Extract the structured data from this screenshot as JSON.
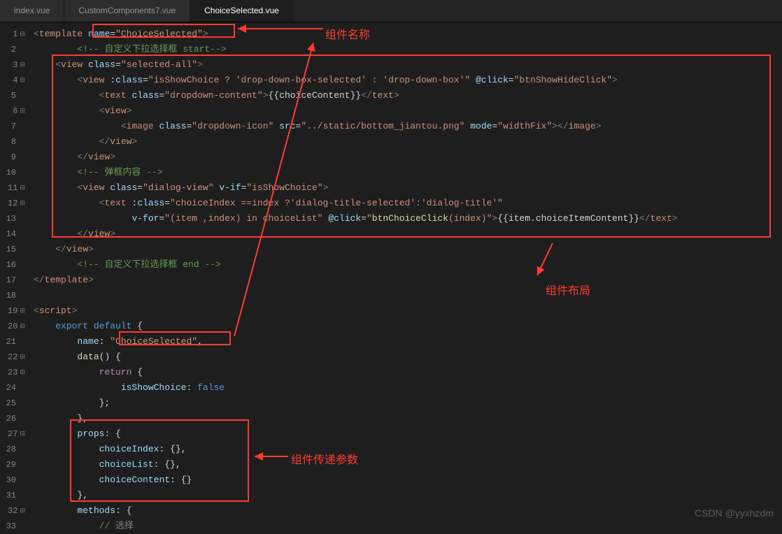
{
  "tabs": [
    "index.vue",
    "CustomComponents7.vue",
    "ChoiceSelected.vue"
  ],
  "active_tab": 2,
  "annotations": {
    "component_name": "组件名称",
    "component_layout": "组件布局",
    "component_props": "组件传递参数"
  },
  "watermark": "CSDN @yyxhzdm",
  "code_lines": [
    {
      "n": 1,
      "fold": true,
      "tokens": [
        [
          "br",
          "<"
        ],
        [
          "tag",
          "template"
        ],
        [
          "txt",
          " "
        ],
        [
          "attr",
          "name"
        ],
        [
          "op",
          "="
        ],
        [
          "str",
          "\"ChoiceSelected\""
        ],
        [
          "br",
          ">"
        ]
      ]
    },
    {
      "n": 2,
      "tokens": [
        [
          "sp",
          "        "
        ],
        [
          "cmt",
          "<!-- 自定义下拉选择框 start-->"
        ]
      ]
    },
    {
      "n": 3,
      "fold": true,
      "tokens": [
        [
          "sp",
          "    "
        ],
        [
          "br",
          "<"
        ],
        [
          "tag",
          "view"
        ],
        [
          "txt",
          " "
        ],
        [
          "attr",
          "class"
        ],
        [
          "op",
          "="
        ],
        [
          "str",
          "\"selected-all\""
        ],
        [
          "br",
          ">"
        ]
      ]
    },
    {
      "n": 4,
      "fold": true,
      "tokens": [
        [
          "sp",
          "        "
        ],
        [
          "br",
          "<"
        ],
        [
          "tag",
          "view"
        ],
        [
          "txt",
          " "
        ],
        [
          "attr",
          ":class"
        ],
        [
          "op",
          "="
        ],
        [
          "str",
          "\"isShowChoice ? 'drop-down-box-selected' : 'drop-down-box'\""
        ],
        [
          "txt",
          " "
        ],
        [
          "attr",
          "@click"
        ],
        [
          "op",
          "="
        ],
        [
          "str",
          "\"btnShowHideClick\""
        ],
        [
          "br",
          ">"
        ]
      ]
    },
    {
      "n": 5,
      "tokens": [
        [
          "sp",
          "            "
        ],
        [
          "br",
          "<"
        ],
        [
          "tag",
          "text"
        ],
        [
          "txt",
          " "
        ],
        [
          "attr",
          "class"
        ],
        [
          "op",
          "="
        ],
        [
          "str",
          "\"dropdown-content\""
        ],
        [
          "br",
          ">"
        ],
        [
          "txt",
          "{{choiceContent}}"
        ],
        [
          "br",
          "</"
        ],
        [
          "tag",
          "text"
        ],
        [
          "br",
          ">"
        ]
      ]
    },
    {
      "n": 6,
      "fold": true,
      "tokens": [
        [
          "sp",
          "            "
        ],
        [
          "br",
          "<"
        ],
        [
          "tag",
          "view"
        ],
        [
          "br",
          ">"
        ]
      ]
    },
    {
      "n": 7,
      "tokens": [
        [
          "sp",
          "                "
        ],
        [
          "br",
          "<"
        ],
        [
          "tag",
          "image"
        ],
        [
          "txt",
          " "
        ],
        [
          "attr",
          "class"
        ],
        [
          "op",
          "="
        ],
        [
          "str",
          "\"dropdown-icon\""
        ],
        [
          "txt",
          " "
        ],
        [
          "attr",
          "src"
        ],
        [
          "op",
          "="
        ],
        [
          "str",
          "\"../static/bottom_jiantou.png\""
        ],
        [
          "txt",
          " "
        ],
        [
          "attr",
          "mode"
        ],
        [
          "op",
          "="
        ],
        [
          "str",
          "\"widthFix\""
        ],
        [
          "br",
          "></"
        ],
        [
          "tag",
          "image"
        ],
        [
          "br",
          ">"
        ]
      ]
    },
    {
      "n": 8,
      "tokens": [
        [
          "sp",
          "            "
        ],
        [
          "br",
          "</"
        ],
        [
          "tag",
          "view"
        ],
        [
          "br",
          ">"
        ]
      ]
    },
    {
      "n": 9,
      "tokens": [
        [
          "sp",
          "        "
        ],
        [
          "br",
          "</"
        ],
        [
          "tag",
          "view"
        ],
        [
          "br",
          ">"
        ]
      ]
    },
    {
      "n": 10,
      "tokens": [
        [
          "sp",
          "        "
        ],
        [
          "cmt",
          "<!-- 弹框内容 -->"
        ]
      ]
    },
    {
      "n": 11,
      "fold": true,
      "tokens": [
        [
          "sp",
          "        "
        ],
        [
          "br",
          "<"
        ],
        [
          "tag",
          "view"
        ],
        [
          "txt",
          " "
        ],
        [
          "attr",
          "class"
        ],
        [
          "op",
          "="
        ],
        [
          "str",
          "\"dialog-view\""
        ],
        [
          "txt",
          " "
        ],
        [
          "attr",
          "v-if"
        ],
        [
          "op",
          "="
        ],
        [
          "str",
          "\"isShowChoice\""
        ],
        [
          "br",
          ">"
        ]
      ]
    },
    {
      "n": 12,
      "fold": true,
      "tokens": [
        [
          "sp",
          "            "
        ],
        [
          "br",
          "<"
        ],
        [
          "tag",
          "text"
        ],
        [
          "txt",
          " "
        ],
        [
          "attr",
          ":class"
        ],
        [
          "op",
          "="
        ],
        [
          "str",
          "\"choiceIndex ==index ?'dialog-title-selected':'dialog-title'\""
        ]
      ]
    },
    {
      "n": 13,
      "tokens": [
        [
          "sp",
          "                  "
        ],
        [
          "attr",
          "v-for"
        ],
        [
          "op",
          "="
        ],
        [
          "str",
          "\"(item ,index) in choiceList\""
        ],
        [
          "txt",
          " "
        ],
        [
          "attr",
          "@click"
        ],
        [
          "op",
          "="
        ],
        [
          "str",
          "\""
        ],
        [
          "fn",
          "btnChoiceClick"
        ],
        [
          "str",
          "(index)\""
        ],
        [
          "br",
          ">"
        ],
        [
          "txt",
          "{{item.choiceItemContent}}"
        ],
        [
          "br",
          "</"
        ],
        [
          "tag",
          "text"
        ],
        [
          "br",
          ">"
        ]
      ]
    },
    {
      "n": 14,
      "tokens": [
        [
          "sp",
          "        "
        ],
        [
          "br",
          "</"
        ],
        [
          "tag",
          "view"
        ],
        [
          "br",
          ">"
        ]
      ]
    },
    {
      "n": 15,
      "tokens": [
        [
          "sp",
          "    "
        ],
        [
          "br",
          "</"
        ],
        [
          "tag",
          "view"
        ],
        [
          "br",
          ">"
        ]
      ]
    },
    {
      "n": 16,
      "tokens": [
        [
          "sp",
          "        "
        ],
        [
          "cmt",
          "<!-- 自定义下拉选择框 end -->"
        ]
      ]
    },
    {
      "n": 17,
      "tokens": [
        [
          "br",
          "</"
        ],
        [
          "tag",
          "template"
        ],
        [
          "br",
          ">"
        ]
      ]
    },
    {
      "n": 18,
      "tokens": []
    },
    {
      "n": 19,
      "fold": true,
      "tokens": [
        [
          "br",
          "<"
        ],
        [
          "tag",
          "script"
        ],
        [
          "br",
          ">"
        ]
      ]
    },
    {
      "n": 20,
      "fold": true,
      "tokens": [
        [
          "sp",
          "    "
        ],
        [
          "kw",
          "export"
        ],
        [
          "txt",
          " "
        ],
        [
          "kw",
          "default"
        ],
        [
          "txt",
          " {"
        ]
      ]
    },
    {
      "n": 21,
      "tokens": [
        [
          "sp",
          "        "
        ],
        [
          "prop",
          "name"
        ],
        [
          "txt",
          ": "
        ],
        [
          "str",
          "\"ChoiceSelected\""
        ],
        [
          "txt",
          ","
        ]
      ]
    },
    {
      "n": 22,
      "fold": true,
      "tokens": [
        [
          "sp",
          "        "
        ],
        [
          "fn",
          "data"
        ],
        [
          "txt",
          "() {"
        ]
      ]
    },
    {
      "n": 23,
      "fold": true,
      "tokens": [
        [
          "sp",
          "            "
        ],
        [
          "kw2",
          "return"
        ],
        [
          "txt",
          " {"
        ]
      ]
    },
    {
      "n": 24,
      "tokens": [
        [
          "sp",
          "                "
        ],
        [
          "prop",
          "isShowChoice"
        ],
        [
          "txt",
          ": "
        ],
        [
          "kw",
          "false"
        ]
      ]
    },
    {
      "n": 25,
      "tokens": [
        [
          "sp",
          "            "
        ],
        [
          "txt",
          "};"
        ]
      ]
    },
    {
      "n": 26,
      "tokens": [
        [
          "sp",
          "        "
        ],
        [
          "txt",
          "},"
        ]
      ]
    },
    {
      "n": 27,
      "fold": true,
      "tokens": [
        [
          "sp",
          "        "
        ],
        [
          "prop",
          "props"
        ],
        [
          "txt",
          ": {"
        ]
      ]
    },
    {
      "n": 28,
      "tokens": [
        [
          "sp",
          "            "
        ],
        [
          "prop",
          "choiceIndex"
        ],
        [
          "txt",
          ": {},"
        ]
      ]
    },
    {
      "n": 29,
      "tokens": [
        [
          "sp",
          "            "
        ],
        [
          "prop",
          "choiceList"
        ],
        [
          "txt",
          ": {},"
        ]
      ]
    },
    {
      "n": 30,
      "tokens": [
        [
          "sp",
          "            "
        ],
        [
          "prop",
          "choiceContent"
        ],
        [
          "txt",
          ": {}"
        ]
      ]
    },
    {
      "n": 31,
      "tokens": [
        [
          "sp",
          "        "
        ],
        [
          "txt",
          "},"
        ]
      ]
    },
    {
      "n": 32,
      "fold": true,
      "tokens": [
        [
          "sp",
          "        "
        ],
        [
          "prop",
          "methods"
        ],
        [
          "txt",
          ": {"
        ]
      ]
    },
    {
      "n": 33,
      "tokens": [
        [
          "sp",
          "            "
        ],
        [
          "cmt2",
          "// 选择"
        ]
      ]
    }
  ]
}
